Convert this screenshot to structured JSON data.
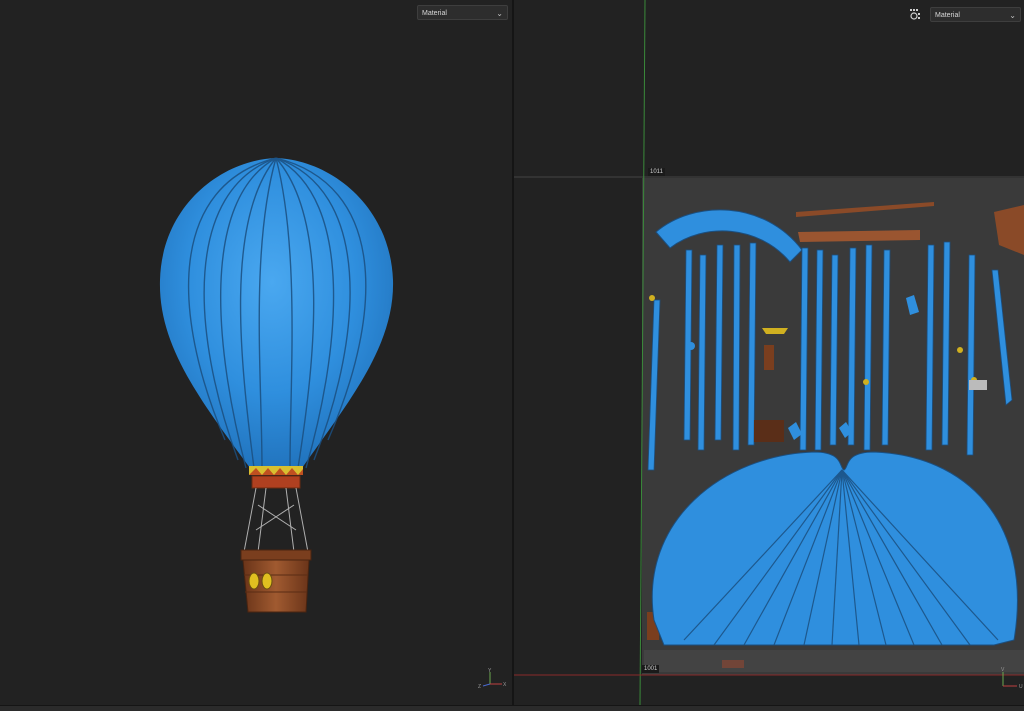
{
  "viewport_3d": {
    "display_mode": "Material",
    "chevron_icon": "chevron-down-icon",
    "axis_gizmo": {
      "y": "Y",
      "z": "Z",
      "x": "X"
    }
  },
  "viewport_uv": {
    "display_mode": "Material",
    "chevron_icon": "chevron-down-icon",
    "settings_icon": "grid-settings-icon",
    "tile_label_top": "1011",
    "tile_label_bottom": "1001",
    "axis_gizmo": {
      "v": "V",
      "u": "U"
    }
  },
  "colors": {
    "balloon_blue": "#2f8fde",
    "basket_brown": "#8a4a28",
    "uv_background": "#3a3a3a",
    "guide_green": "#3a8a3a",
    "guide_red": "#8a2a2a"
  }
}
